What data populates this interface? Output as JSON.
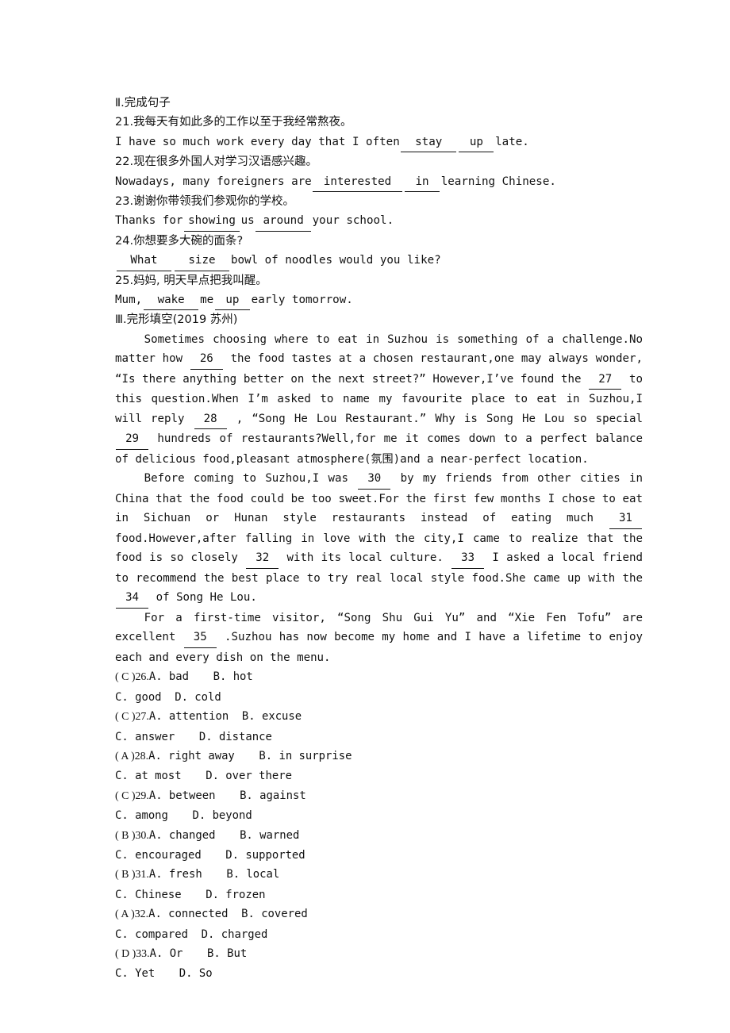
{
  "section_two": {
    "heading": "Ⅱ.完成句子",
    "items": [
      {
        "number": "21.",
        "chinese": "我每天有如此多的工作以至于我经常熬夜。",
        "english_pre": "I have so much work every day that I often",
        "blanks": [
          "stay",
          "up"
        ],
        "english_post": "late."
      },
      {
        "number": "22.",
        "chinese": "现在很多外国人对学习汉语感兴趣。",
        "english_pre": "Nowadays, many foreigners are",
        "blanks": [
          "interested",
          "in"
        ],
        "english_post": "learning Chinese."
      },
      {
        "number": "23.",
        "chinese": "谢谢你带领我们参观你的学校。",
        "english_pre": "Thanks for",
        "blanks": [
          "showing",
          "around"
        ],
        "english_mid": "us",
        "english_post": "your school."
      },
      {
        "number": "24.",
        "chinese": "你想要多大碗的面条?",
        "english_pre": "",
        "blanks": [
          "What",
          "size"
        ],
        "english_post": "bowl of noodles would you like?"
      },
      {
        "number": "25.",
        "chinese": "妈妈, 明天早点把我叫醒。",
        "english_pre": "Mum,",
        "blanks": [
          "wake",
          "up"
        ],
        "english_mid": "me",
        "english_post": "early tomorrow."
      }
    ]
  },
  "section_three": {
    "heading": "Ⅲ.完形填空(2019 苏州)",
    "paragraphs": [
      {
        "id": "p1",
        "runs": [
          {
            "t": "text",
            "v": "Sometimes choosing where to eat in Suzhou is something of a challenge.No matter how"
          },
          {
            "t": "blank",
            "v": "26"
          },
          {
            "t": "text",
            "v": "the food tastes at a chosen restaurant,one may always wonder, “Is there anything better on the next street?”  However,I’ve found the"
          },
          {
            "t": "blank",
            "v": "27"
          },
          {
            "t": "text",
            "v": "to this question.When I’m asked to name my favourite place to eat in Suzhou,I will reply"
          },
          {
            "t": "blank",
            "v": "28"
          },
          {
            "t": "text",
            "v": ", “Song He Lou Restaurant.” Why is Song He Lou so special"
          },
          {
            "t": "blank",
            "v": "29"
          },
          {
            "t": "text",
            "v": "hundreds of restaurants?Well,for me it comes down to a perfect balance of delicious food,pleasant atmosphere(氛围)and a near-perfect location."
          }
        ]
      },
      {
        "id": "p2",
        "runs": [
          {
            "t": "text",
            "v": "Before coming to Suzhou,I was"
          },
          {
            "t": "blank",
            "v": "30"
          },
          {
            "t": "text",
            "v": "by my friends from other cities in China that the food could be too sweet.For the first few months I chose to eat in Sichuan or Hunan style restaurants instead of eating much"
          },
          {
            "t": "blank",
            "v": "31"
          },
          {
            "t": "text",
            "v": "food.However,after falling in love with the city,I came to realize that the food is so closely"
          },
          {
            "t": "blank",
            "v": "32"
          },
          {
            "t": "text",
            "v": "with its local culture."
          },
          {
            "t": "blank",
            "v": "33"
          },
          {
            "t": "text",
            "v": "I asked a local friend to recommend the best place to try real local style food.She came up with the"
          },
          {
            "t": "blank",
            "v": "34"
          },
          {
            "t": "text",
            "v": "of Song He Lou."
          }
        ]
      },
      {
        "id": "p3",
        "runs": [
          {
            "t": "text",
            "v": "For a first-time visitor, “Song Shu Gui Yu”  and  “Xie Fen Tofu”  are excellent"
          },
          {
            "t": "blank",
            "v": "35"
          },
          {
            "t": "text",
            "v": ".Suzhou has now become my home and I have a lifetime to enjoy each and every dish on the menu."
          }
        ]
      }
    ],
    "questions": [
      {
        "answer": "C",
        "number": "26.",
        "a": "A. bad",
        "b": "B. hot",
        "c": "C. good",
        "d": "D. cold",
        "gap_ab": "gap-m",
        "gap_cd": "gap-s"
      },
      {
        "answer": "C",
        "number": "27.",
        "a": "A. attention",
        "b": "B. excuse",
        "c": "C. answer",
        "d": "D. distance",
        "gap_ab": "gap-s",
        "gap_cd": "gap-m"
      },
      {
        "answer": "A",
        "number": "28.",
        "a": "A. right away",
        "b": "B. in surprise",
        "c": "C. at most",
        "d": "D. over there",
        "gap_ab": "gap-m",
        "gap_cd": "gap-m"
      },
      {
        "answer": "C",
        "number": "29.",
        "a": "A. between",
        "b": "B. against",
        "c": "C. among",
        "d": "D. beyond",
        "gap_ab": "gap-m",
        "gap_cd": "gap-m"
      },
      {
        "answer": "B",
        "number": "30.",
        "a": "A. changed",
        "b": "B. warned",
        "c": "C. encouraged",
        "d": "D. supported",
        "gap_ab": "gap-m",
        "gap_cd": "gap-m"
      },
      {
        "answer": "B",
        "number": "31.",
        "a": "A. fresh",
        "b": "B. local",
        "c": "C. Chinese",
        "d": "D. frozen",
        "gap_ab": "gap-m",
        "gap_cd": "gap-m"
      },
      {
        "answer": "A",
        "number": "32.",
        "a": "A. connected",
        "b": "B. covered",
        "c": "C. compared",
        "d": "D. charged",
        "gap_ab": "gap-s",
        "gap_cd": "gap-s"
      },
      {
        "answer": "D",
        "number": "33.",
        "a": "A. Or",
        "b": "B. But",
        "c": "C. Yet",
        "d": "D. So",
        "gap_ab": "gap-m",
        "gap_cd": "gap-m"
      }
    ]
  }
}
